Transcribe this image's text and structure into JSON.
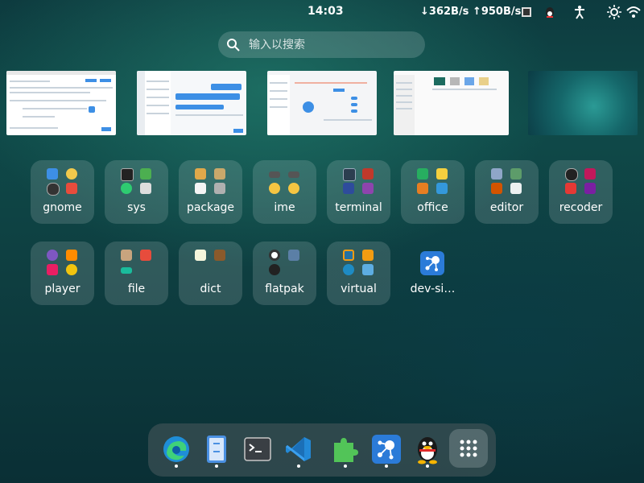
{
  "topbar": {
    "clock": "14:03",
    "network_speed": "↓362B/s ↑950B/s"
  },
  "search": {
    "placeholder": "输入以搜索"
  },
  "folders_row1": [
    {
      "label": "gnome"
    },
    {
      "label": "sys"
    },
    {
      "label": "package"
    },
    {
      "label": "ime"
    },
    {
      "label": "terminal"
    },
    {
      "label": "office"
    },
    {
      "label": "editor"
    },
    {
      "label": "recoder"
    }
  ],
  "folders_row2": [
    {
      "label": "player"
    },
    {
      "label": "file"
    },
    {
      "label": "dict"
    },
    {
      "label": "flatpak"
    },
    {
      "label": "virtual"
    }
  ],
  "apps": [
    {
      "label": "dev-si…"
    }
  ],
  "dock": {
    "items": [
      "edge-icon",
      "file-manager-icon",
      "terminal-icon",
      "vscode-icon",
      "extensions-icon",
      "dev-sidecar-icon",
      "qq-icon",
      "show-apps-icon"
    ]
  },
  "colors": {
    "accent": "#3d8fe5",
    "folder_bg": "rgba(255,255,255,0.14)"
  }
}
